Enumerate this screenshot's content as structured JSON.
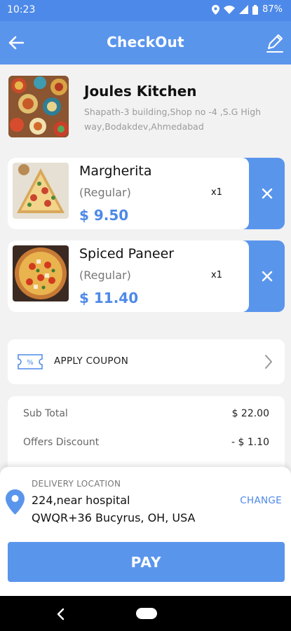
{
  "status_bar": {
    "time": "10:23",
    "battery": "87%"
  },
  "header": {
    "title": "CheckOut"
  },
  "restaurant": {
    "name": "Joules Kitchen",
    "address": "Shapath-3 building,Shop no -4 ,S.G High way,Bodakdev,Ahmedabad"
  },
  "items": [
    {
      "name": "Margherita",
      "variant": "(Regular)",
      "qty": "x1",
      "price": "$ 9.50"
    },
    {
      "name": "Spiced Paneer",
      "variant": "(Regular)",
      "qty": "x1",
      "price": "$ 11.40"
    }
  ],
  "coupon": {
    "label": "APPLY COUPON"
  },
  "summary": {
    "subtotal_label": "Sub Total",
    "subtotal_value": "$ 22.00",
    "discount_label": "Offers Discount",
    "discount_value": "- $ 1.10"
  },
  "delivery": {
    "label": "DELIVERY LOCATION",
    "line1": "224,near hospital",
    "line2": "QWQR+36 Bucyrus, OH, USA",
    "change_label": "CHANGE"
  },
  "pay_label": "PAY",
  "colors": {
    "primary": "#5a95ec",
    "price": "#4d89e8",
    "background": "#f2f2f2"
  }
}
